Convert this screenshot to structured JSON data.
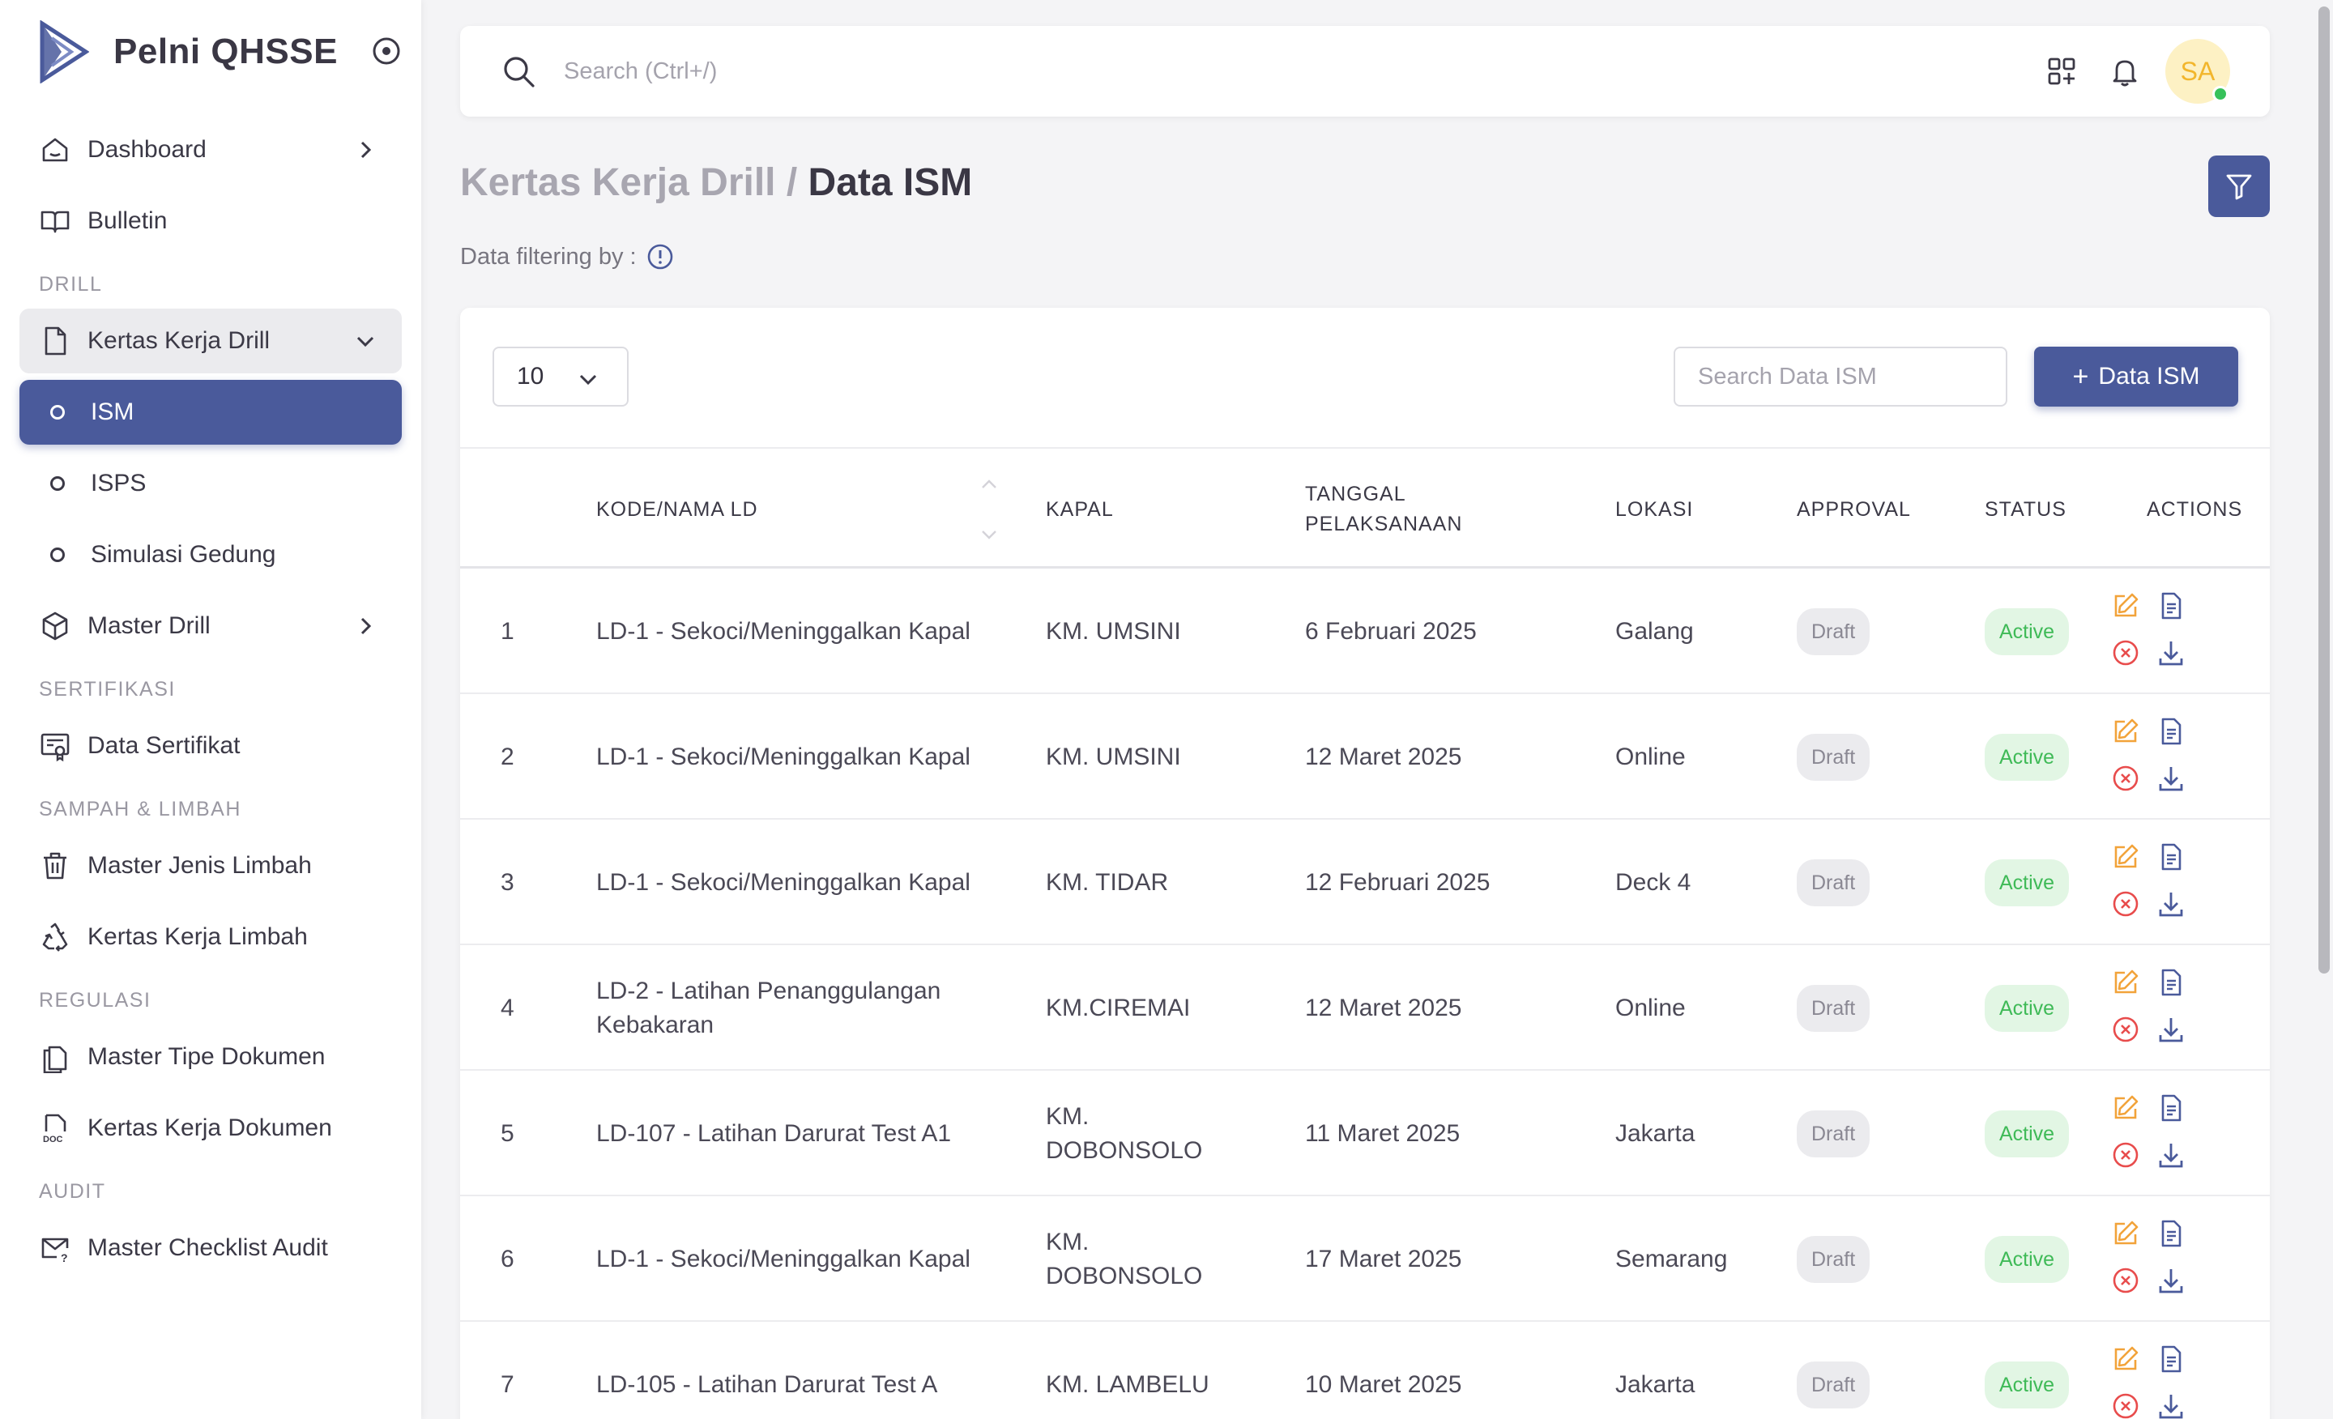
{
  "brand": {
    "title": "Pelni QHSSE"
  },
  "sidebar": {
    "dashboard": "Dashboard",
    "bulletin": "Bulletin",
    "section_drill": "DRILL",
    "kertas_kerja_drill": "Kertas Kerja Drill",
    "ism": "ISM",
    "isps": "ISPS",
    "simulasi_gedung": "Simulasi Gedung",
    "master_drill": "Master Drill",
    "section_sertifikasi": "SERTIFIKASI",
    "data_sertifikat": "Data Sertifikat",
    "section_sampah": "SAMPAH & LIMBAH",
    "master_jenis_limbah": "Master Jenis Limbah",
    "kertas_kerja_limbah": "Kertas Kerja Limbah",
    "section_regulasi": "REGULASI",
    "master_tipe_dokumen": "Master Tipe Dokumen",
    "kertas_kerja_dokumen": "Kertas Kerja Dokumen",
    "section_audit": "AUDIT",
    "master_checklist_audit": "Master Checklist Audit"
  },
  "topbar": {
    "search_placeholder": "Search (Ctrl+/)",
    "avatar_initials": "SA"
  },
  "page": {
    "breadcrumb_parent": "Kertas Kerja Drill /",
    "title": "Data ISM",
    "filter_note": "Data filtering by :"
  },
  "table_controls": {
    "per_page": "10",
    "search_placeholder": "Search Data ISM",
    "add_label": "Data ISM"
  },
  "columns": {
    "kode": "KODE/NAMA LD",
    "kapal": "KAPAL",
    "tanggal": "TANGGAL PELAKSANAAN",
    "lokasi": "LOKASI",
    "approval": "APPROVAL",
    "status": "STATUS",
    "actions": "ACTIONS"
  },
  "rows": [
    {
      "no": "1",
      "kode": "LD-1 - Sekoci/Meninggalkan Kapal",
      "kapal": "KM. UMSINI",
      "tanggal": "6 Februari 2025",
      "lokasi": "Galang",
      "approval": "Draft",
      "status": "Active"
    },
    {
      "no": "2",
      "kode": "LD-1 - Sekoci/Meninggalkan Kapal",
      "kapal": "KM. UMSINI",
      "tanggal": "12 Maret 2025",
      "lokasi": "Online",
      "approval": "Draft",
      "status": "Active"
    },
    {
      "no": "3",
      "kode": "LD-1 - Sekoci/Meninggalkan Kapal",
      "kapal": "KM. TIDAR",
      "tanggal": "12 Februari 2025",
      "lokasi": "Deck 4",
      "approval": "Draft",
      "status": "Active"
    },
    {
      "no": "4",
      "kode": "LD-2 - Latihan Penanggulangan Kebakaran",
      "kapal": "KM.CIREMAI",
      "tanggal": "12 Maret 2025",
      "lokasi": "Online",
      "approval": "Draft",
      "status": "Active"
    },
    {
      "no": "5",
      "kode": "LD-107 - Latihan Darurat Test A1",
      "kapal": "KM. DOBONSOLO",
      "tanggal": "11 Maret 2025",
      "lokasi": "Jakarta",
      "approval": "Draft",
      "status": "Active"
    },
    {
      "no": "6",
      "kode": "LD-1 - Sekoci/Meninggalkan Kapal",
      "kapal": "KM. DOBONSOLO",
      "tanggal": "17 Maret 2025",
      "lokasi": "Semarang",
      "approval": "Draft",
      "status": "Active"
    },
    {
      "no": "7",
      "kode": "LD-105 - Latihan Darurat Test A",
      "kapal": "KM. LAMBELU",
      "tanggal": "10 Maret 2025",
      "lokasi": "Jakarta",
      "approval": "Draft",
      "status": "Active"
    }
  ],
  "colors": {
    "primary": "#4a5a9b",
    "active_badge": "#3fba57",
    "draft_badge": "#8a8893",
    "edit_icon": "#f2a33a",
    "delete_icon": "#e84c4c"
  }
}
